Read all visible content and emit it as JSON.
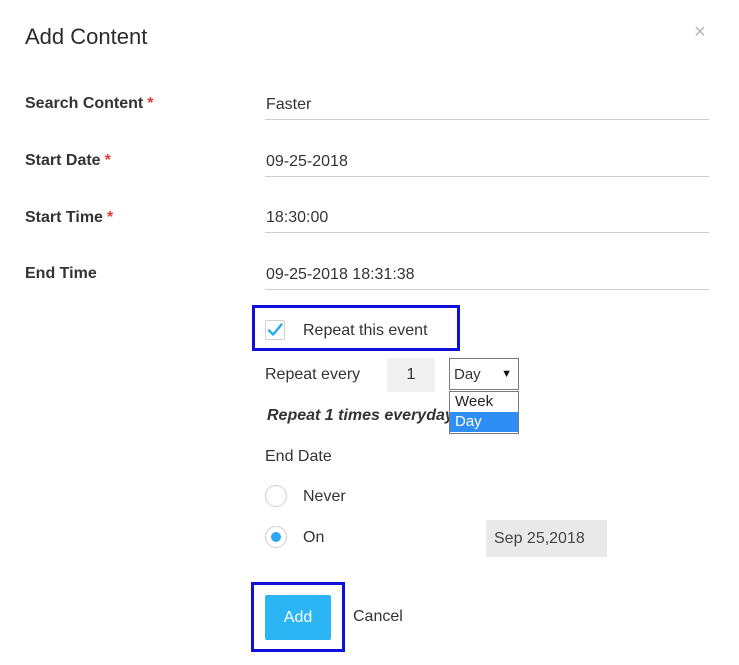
{
  "dialog": {
    "title": "Add Content",
    "close_glyph": "×"
  },
  "fields": [
    {
      "label": "Search Content",
      "required": true,
      "value": "Faster"
    },
    {
      "label": "Start Date",
      "required": true,
      "value": "09-25-2018"
    },
    {
      "label": "Start Time",
      "required": true,
      "value": "18:30:00"
    },
    {
      "label": "End Time",
      "required": false,
      "value": "09-25-2018 18:31:38"
    }
  ],
  "repeat": {
    "checkbox_label": "Repeat this event",
    "checked": true,
    "every_label": "Repeat every",
    "every_value": "1",
    "unit_selected": "Day",
    "unit_options": [
      "Week",
      "Day"
    ],
    "summary": "Repeat 1 times everyday"
  },
  "end_date": {
    "label": "End Date",
    "never_label": "Never",
    "on_label": "On",
    "selected": "On",
    "on_date": "Sep 25,2018"
  },
  "actions": {
    "add_label": "Add",
    "cancel_label": "Cancel"
  },
  "colors": {
    "required": "#e53935",
    "accent": "#2bb5f4",
    "highlight": "#1010d8",
    "option_selected": "#2f8ef5"
  }
}
